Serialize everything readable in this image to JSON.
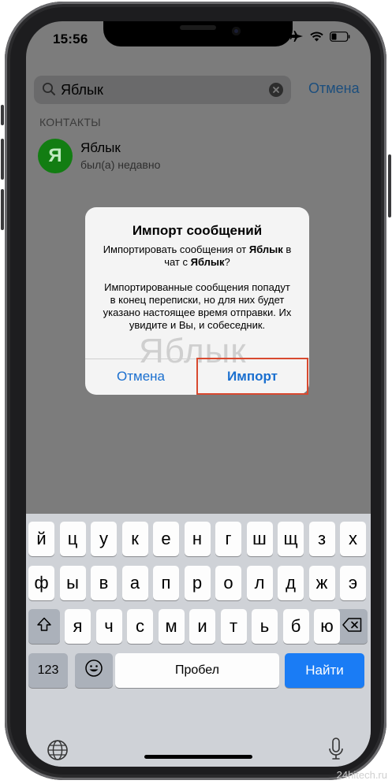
{
  "status_bar": {
    "time": "15:56"
  },
  "search": {
    "value": "Яблык",
    "cancel_label": "Отмена"
  },
  "contacts_section": {
    "header": "КОНТАКТЫ",
    "items": [
      {
        "avatar_letter": "Я",
        "name": "Яблык",
        "status": "был(а) недавно"
      }
    ]
  },
  "alert": {
    "title": "Импорт сообщений",
    "question_prefix": "Импортировать сообщения от ",
    "from_name": "Яблык",
    "question_middle": " в чат с ",
    "to_name": "Яблык",
    "question_suffix": "?",
    "body": "Импортированные сообщения попадут в конец переписки, но для них будет указано настоящее время отправки. Их увидите и Вы, и собеседник.",
    "watermark": "Яблык",
    "cancel_label": "Отмена",
    "import_label": "Импорт"
  },
  "keyboard": {
    "row1": [
      "й",
      "ц",
      "у",
      "к",
      "е",
      "н",
      "г",
      "ш",
      "щ",
      "з",
      "х"
    ],
    "row2": [
      "ф",
      "ы",
      "в",
      "а",
      "п",
      "р",
      "о",
      "л",
      "д",
      "ж",
      "э"
    ],
    "row3": [
      "я",
      "ч",
      "с",
      "м",
      "и",
      "т",
      "ь",
      "б",
      "ю"
    ],
    "numbers_label": "123",
    "space_label": "Пробел",
    "go_label": "Найти"
  },
  "site_watermark": "24hitech.ru",
  "colors": {
    "accent": "#1a6fcf",
    "go_key": "#1a7cf5",
    "avatar": "#127d12",
    "highlight": "#d8492f"
  }
}
